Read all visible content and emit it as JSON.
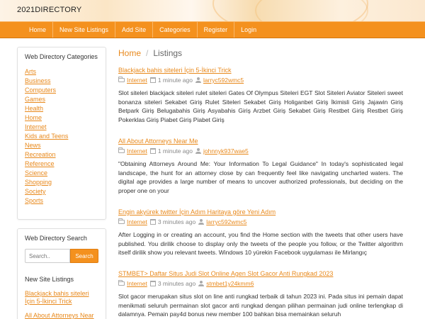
{
  "site": {
    "title": "2021DIRECTORY"
  },
  "nav": {
    "items": [
      {
        "label": "Home"
      },
      {
        "label": "New Site Listings"
      },
      {
        "label": "Add Site"
      },
      {
        "label": "Categories"
      },
      {
        "label": "Register"
      },
      {
        "label": "Login"
      }
    ]
  },
  "sidebar": {
    "categories_title": "Web Directory Categories",
    "categories": [
      "Arts",
      "Business",
      "Computers",
      "Games",
      "Health",
      "Home",
      "Internet",
      "Kids and Teens",
      "News",
      "Recreation",
      "Reference",
      "Science",
      "Shopping",
      "Society",
      "Sports"
    ],
    "search_title": "Web Directory Search",
    "search_placeholder": "Search..",
    "search_button": "Search",
    "new_listings_title": "New Site Listings",
    "new_listings": [
      "Blackjack bahis siteleri İçin 5-İkinci Trick",
      "All About Attorneys Near"
    ]
  },
  "breadcrumb": {
    "home": "Home",
    "separator": "/",
    "current": "Listings"
  },
  "listings": [
    {
      "title": "Blackjack bahis siteleri İçin 5-İkinci Trick",
      "category": "Internet",
      "time": "1 minute ago",
      "user": "larryc592wmc5",
      "excerpt": "Slot siteleri blackjack siteleri rulet siteleri Gates Of Olympus Siteleri EGT Slot Siteleri Aviator Siteleri sweet bonanza siteleri Sekabet Giriş Rulet Siteleri Sekabet Giriş Holiganbet Giriş İkimisli Giriş Jajawin Giriş Betpark Giriş Belugabahis Giriş Asyabahis Giriş Arzbet Giriş Sekabet Giriş Restbet Giriş Restbet Giriş Pokerklas Giriş Piabet Giriş Piabet Giriş"
    },
    {
      "title": "All About Attorneys Near Me",
      "category": "Internet",
      "time": "1 minute ago",
      "user": "johnnyk937wae5",
      "excerpt": "\"Obtaining Attorneys Around Me: Your Information To Legal Guidance\" In today's sophisticated legal landscape, the hunt for an attorney close by can frequently feel like navigating uncharted waters. The digital age provides a large number of means to uncover authorized professionals, but deciding on the proper one on your"
    },
    {
      "title": "Engin akyürek twitter İçin Adım Haritaya göre Yeni Adım",
      "category": "Internet",
      "time": "3 minutes ago",
      "user": "larryc592wmc5",
      "excerpt": "After Logging in or creating an account, you find the Home section with the tweets that other users have published. You dirilik choose to display only the tweets of the people you follow, or the Twitter algorithm itself dirilik show you relevant tweets. Windows 10 yürekin Facebook uygulaması ile Mirlangıç"
    },
    {
      "title": "STMBET> Daftar Situs Judi Slot Online Agen Slot Gacor Anti Rungkad 2023",
      "category": "Internet",
      "time": "3 minutes ago",
      "user": "stmbet1y24kmm6",
      "excerpt": "Slot gacor merupakan situs slot on line anti rungkad terbaik di tahun 2023 ini. Pada situs ini pemain dapat menikmati seluruh permainan slot gacor anti rungkad dengan pilihan permainan judi online terlengkap di dalamnya. Pemain pay4d bonus new member 100 bahkan bisa memainkan seluruh"
    }
  ]
}
